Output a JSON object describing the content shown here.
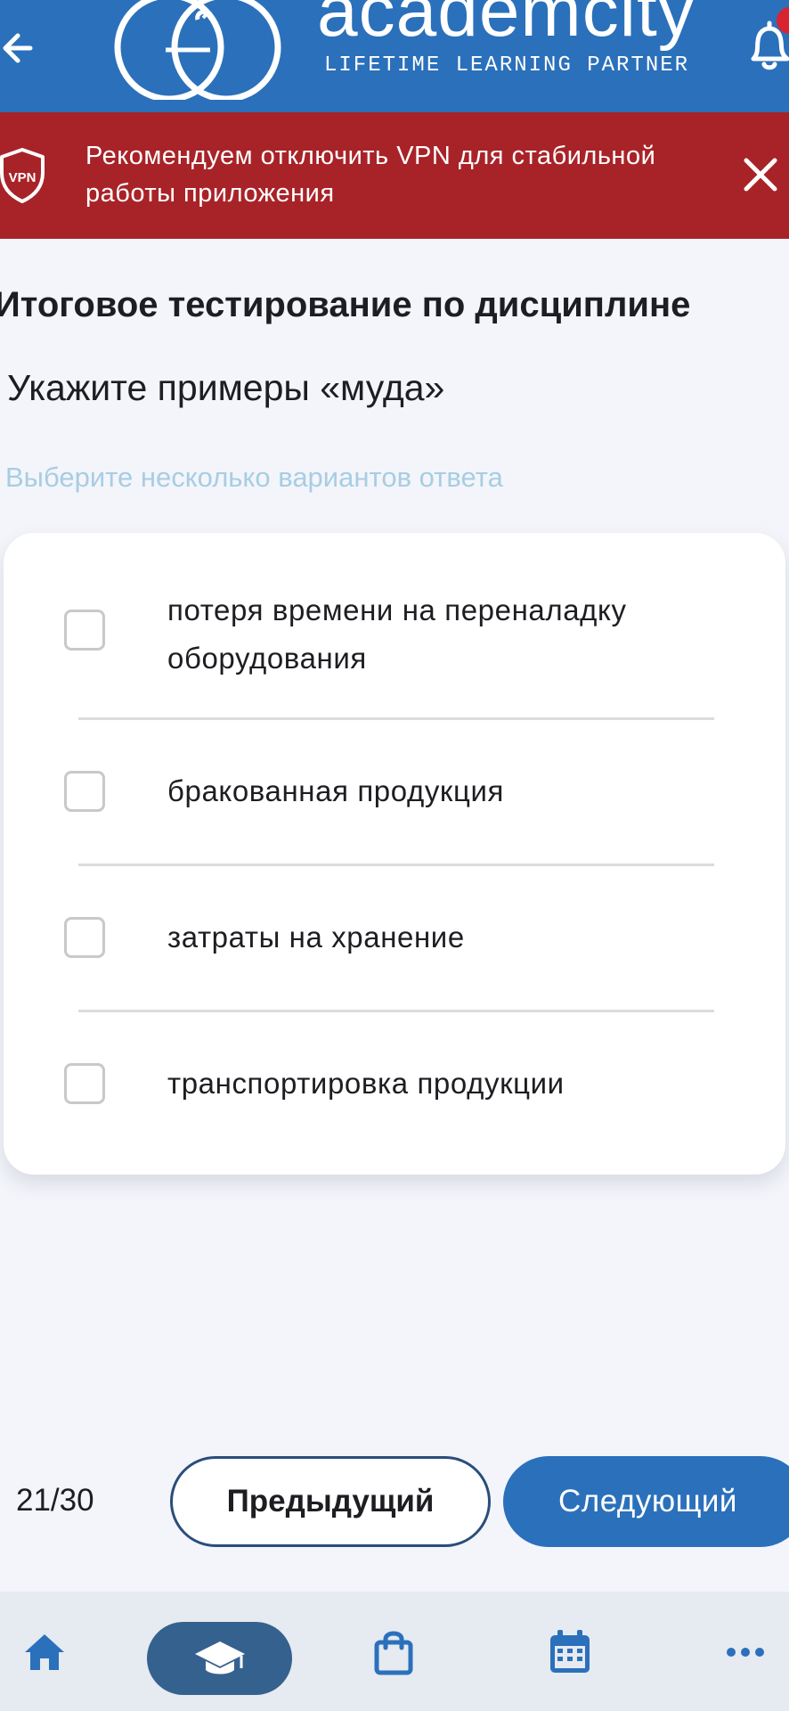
{
  "header": {
    "brand_name": "academcity",
    "brand_tagline": "LIFETIME LEARNING PARTNER",
    "icons": {
      "back": "arrow-left-icon",
      "logo": "academcity-logo-icon",
      "notifications": "bell-icon"
    },
    "notification_dot_color": "#d92330",
    "bar_color": "#2b70bb"
  },
  "vpn_banner": {
    "message": "Рекомендуем отключить VPN для стабильной работы приложения",
    "shield_label": "VPN",
    "icons": {
      "shield": "vpn-shield-icon",
      "close": "close-icon"
    },
    "color": "#a82328"
  },
  "main": {
    "test_title": "Итоговое тестирование по дисциплине",
    "question": "Укажите примеры «муда»",
    "hint": "Выберите несколько вариантов ответа",
    "options": [
      {
        "label": "потеря времени на переналадку оборудования",
        "checked": false
      },
      {
        "label": "бракованная продукция",
        "checked": false
      },
      {
        "label": "затраты на хранение",
        "checked": false
      },
      {
        "label": "транспортировка продукции",
        "checked": false
      }
    ]
  },
  "pagination": {
    "counter": "21/30",
    "prev_label": "Предыдущий",
    "next_label": "Следующий"
  },
  "bottom_nav": {
    "items": [
      {
        "icon": "home-icon",
        "active": false
      },
      {
        "icon": "graduation-cap-icon",
        "active": true
      },
      {
        "icon": "shopping-bag-icon",
        "active": false
      },
      {
        "icon": "calendar-icon",
        "active": false
      },
      {
        "icon": "more-dots-icon",
        "active": false
      }
    ],
    "accent_color": "#35618f"
  }
}
